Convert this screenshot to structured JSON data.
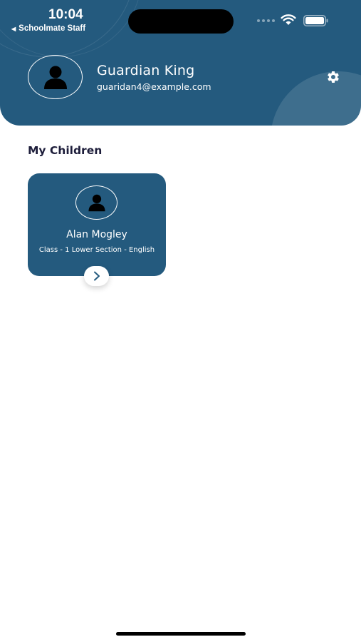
{
  "status_bar": {
    "time": "10:04",
    "back_app": "Schoolmate Staff"
  },
  "profile": {
    "name": "Guardian King",
    "email": "guaridan4@example.com"
  },
  "section": {
    "title": "My Children"
  },
  "children": [
    {
      "name": "Alan Mogley",
      "class_info": "Class - 1 Lower Section - English"
    }
  ],
  "icons": {
    "settings": "gear-icon",
    "avatar": "person-icon",
    "open_child": "chevron-right-icon",
    "back": "back-triangle-icon"
  },
  "colors": {
    "primary": "#245a7e",
    "section_title": "#1d1d3a",
    "background": "#ffffff"
  }
}
